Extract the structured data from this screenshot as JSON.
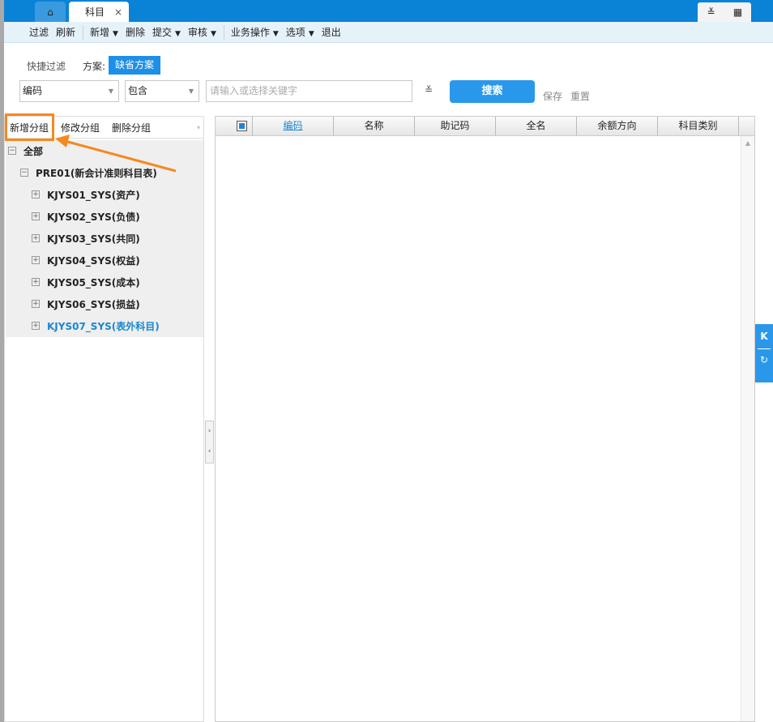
{
  "tabs": [
    {
      "icon": "home-icon",
      "glyph": "⌂"
    },
    {
      "label": "科目",
      "close": "×"
    }
  ],
  "topright": {
    "expand": "≚",
    "grid": "▦"
  },
  "toolbar": {
    "items": [
      {
        "label": "过滤"
      },
      {
        "label": "刷新"
      },
      {
        "label": "新增",
        "menu": "▼"
      },
      {
        "label": "删除"
      },
      {
        "label": "提交",
        "menu": "▼"
      },
      {
        "label": "审核",
        "menu": "▼"
      },
      {
        "label": "业务操作",
        "menu": "▼"
      },
      {
        "label": "选项",
        "menu": "▼"
      },
      {
        "label": "退出"
      }
    ]
  },
  "filter": {
    "quick_filter": "快捷过滤",
    "scheme_label": "方案:",
    "scheme_value": "缺省方案",
    "field": "编码",
    "operator": "包含",
    "keyword_placeholder": "请输入或选择关键字",
    "more": "≚",
    "search": "搜索",
    "save": "保存",
    "reset": "重置"
  },
  "left_panel": {
    "actions": [
      "新增分组",
      "修改分组",
      "删除分组"
    ],
    "tree": [
      {
        "label": "全部",
        "toggle": "−",
        "level": 0
      },
      {
        "label": "PRE01(新会计准则科目表)",
        "toggle": "−",
        "level": 1
      },
      {
        "label": "KJYS01_SYS(资产)",
        "toggle": "+",
        "level": 2
      },
      {
        "label": "KJYS02_SYS(负债)",
        "toggle": "+",
        "level": 2
      },
      {
        "label": "KJYS03_SYS(共同)",
        "toggle": "+",
        "level": 2
      },
      {
        "label": "KJYS04_SYS(权益)",
        "toggle": "+",
        "level": 2
      },
      {
        "label": "KJYS05_SYS(成本)",
        "toggle": "+",
        "level": 2
      },
      {
        "label": "KJYS06_SYS(损益)",
        "toggle": "+",
        "level": 2
      },
      {
        "label": "KJYS07_SYS(表外科目)",
        "toggle": "+",
        "level": 2,
        "selected": true
      }
    ]
  },
  "grid": {
    "columns": [
      "编码",
      "名称",
      "助记码",
      "全名",
      "余额方向",
      "科目类别"
    ],
    "rows": []
  },
  "colors": {
    "accent": "#1e8fe6",
    "highlight": "#f5891f",
    "selected_text": "#1a86d0"
  }
}
